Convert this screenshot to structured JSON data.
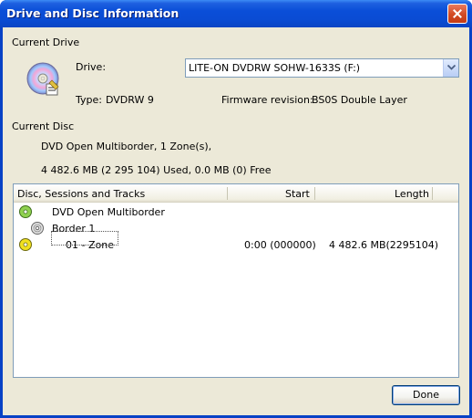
{
  "window": {
    "title": "Drive and Disc Information"
  },
  "current_drive": {
    "section_label": "Current Drive",
    "drive_label": "Drive:",
    "drive_value": "LITE-ON DVDRW SOHW-1633S (F:)",
    "type_label": "Type:",
    "type_value": "DVDRW 9",
    "firmware_label": "Firmware revision:",
    "firmware_value": "BS0S Double Layer"
  },
  "current_disc": {
    "section_label": "Current Disc",
    "description": "DVD Open Multiborder, 1 Zone(s),",
    "usage": "4 482.6 MB (2 295 104) Used, 0.0 MB (0) Free"
  },
  "tracks": {
    "columns": [
      "Disc, Sessions and Tracks",
      "Start",
      "Length"
    ],
    "rows": [
      {
        "name": "DVD Open Multiborder",
        "start": "",
        "length": "",
        "icon": "dvd-disc-icon"
      },
      {
        "name": "Border 1",
        "start": "",
        "length": "",
        "icon": "session-disc-icon"
      },
      {
        "name": "01 - Zone",
        "start": "0:00 (000000)",
        "length": "4 482.6 MB(2295104)",
        "icon": "track-disc-icon"
      }
    ]
  },
  "buttons": {
    "done": "Done"
  },
  "colors": {
    "titlebar": "#0a4ed8",
    "dialog_bg": "#ece9d8",
    "disc_green": "#8fd14f",
    "disc_yellow": "#f0e020"
  }
}
